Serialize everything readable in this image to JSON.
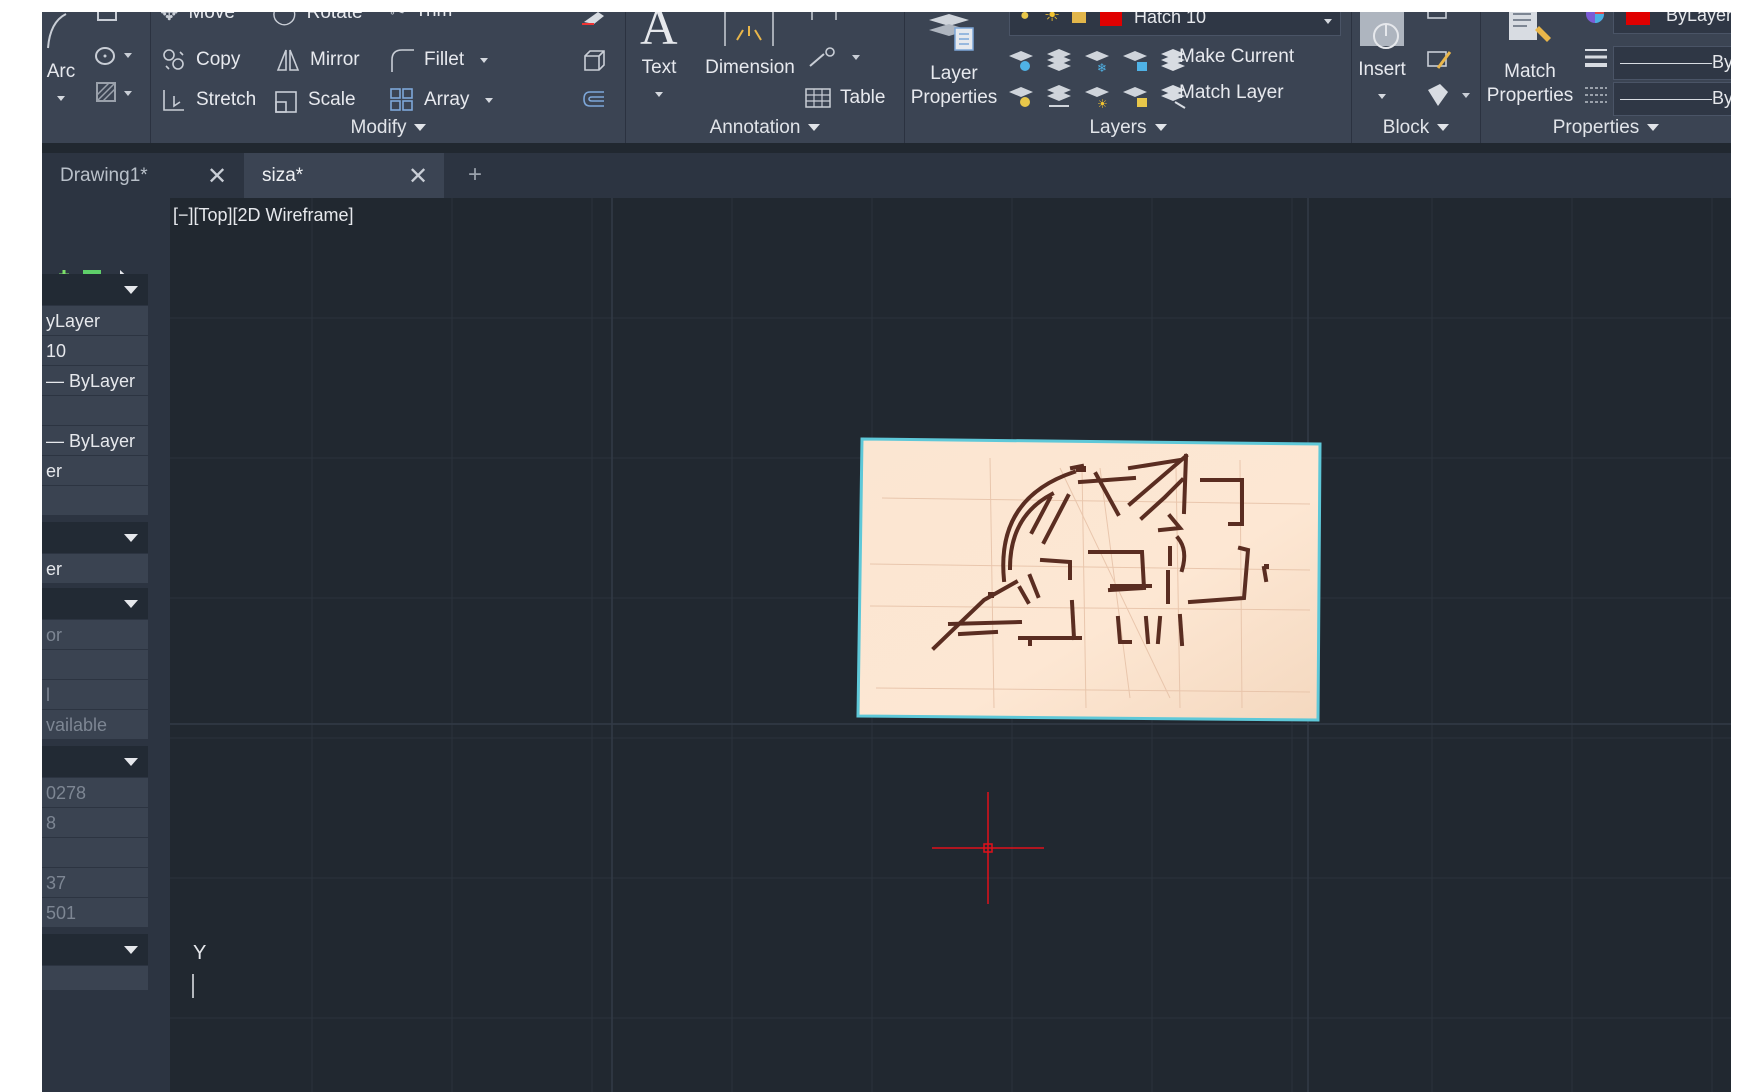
{
  "ribbon": {
    "draw": {
      "arc_label": "Arc"
    },
    "modify": {
      "title": "Modify",
      "move": "Move",
      "rotate": "Rotate",
      "trim": "Trim",
      "copy": "Copy",
      "mirror": "Mirror",
      "fillet": "Fillet",
      "stretch": "Stretch",
      "scale": "Scale",
      "array": "Array"
    },
    "annotation": {
      "title": "Annotation",
      "text": "Text",
      "dimension": "Dimension",
      "table": "Table"
    },
    "layers": {
      "title": "Layers",
      "layer_properties_line1": "Layer",
      "layer_properties_line2": "Properties",
      "current_layer": "Hatch 10",
      "current_layer_color": "#e00000",
      "make_current": "Make Current",
      "match_layer": "Match Layer"
    },
    "block": {
      "title": "Block",
      "insert": "Insert"
    },
    "properties": {
      "title": "Properties",
      "match_line1": "Match",
      "match_line2": "Properties",
      "color_value": "ByLayer",
      "color_swatch": "#e00000",
      "lineweight_value": "ByLaye",
      "linetype_value": "ByLaye"
    }
  },
  "tabs": [
    {
      "label": "Drawing1*"
    },
    {
      "label": "siza*"
    }
  ],
  "new_tab": "+",
  "palette": {
    "rows": [
      "yLayer",
      "10",
      "— ByLayer",
      "",
      "— ByLayer",
      "er",
      "",
      "er",
      "or",
      "",
      "l",
      "vailable",
      "0278",
      "8",
      "",
      "37",
      "501"
    ]
  },
  "viewport": {
    "label": "[−][Top][2D Wireframe]",
    "ucs_axis": "Y"
  },
  "colors": {
    "app_bg": "#212830",
    "ribbon_bg": "#3b4453",
    "selection_cyan": "#5ec8d8",
    "crosshair": "#e0111a"
  }
}
